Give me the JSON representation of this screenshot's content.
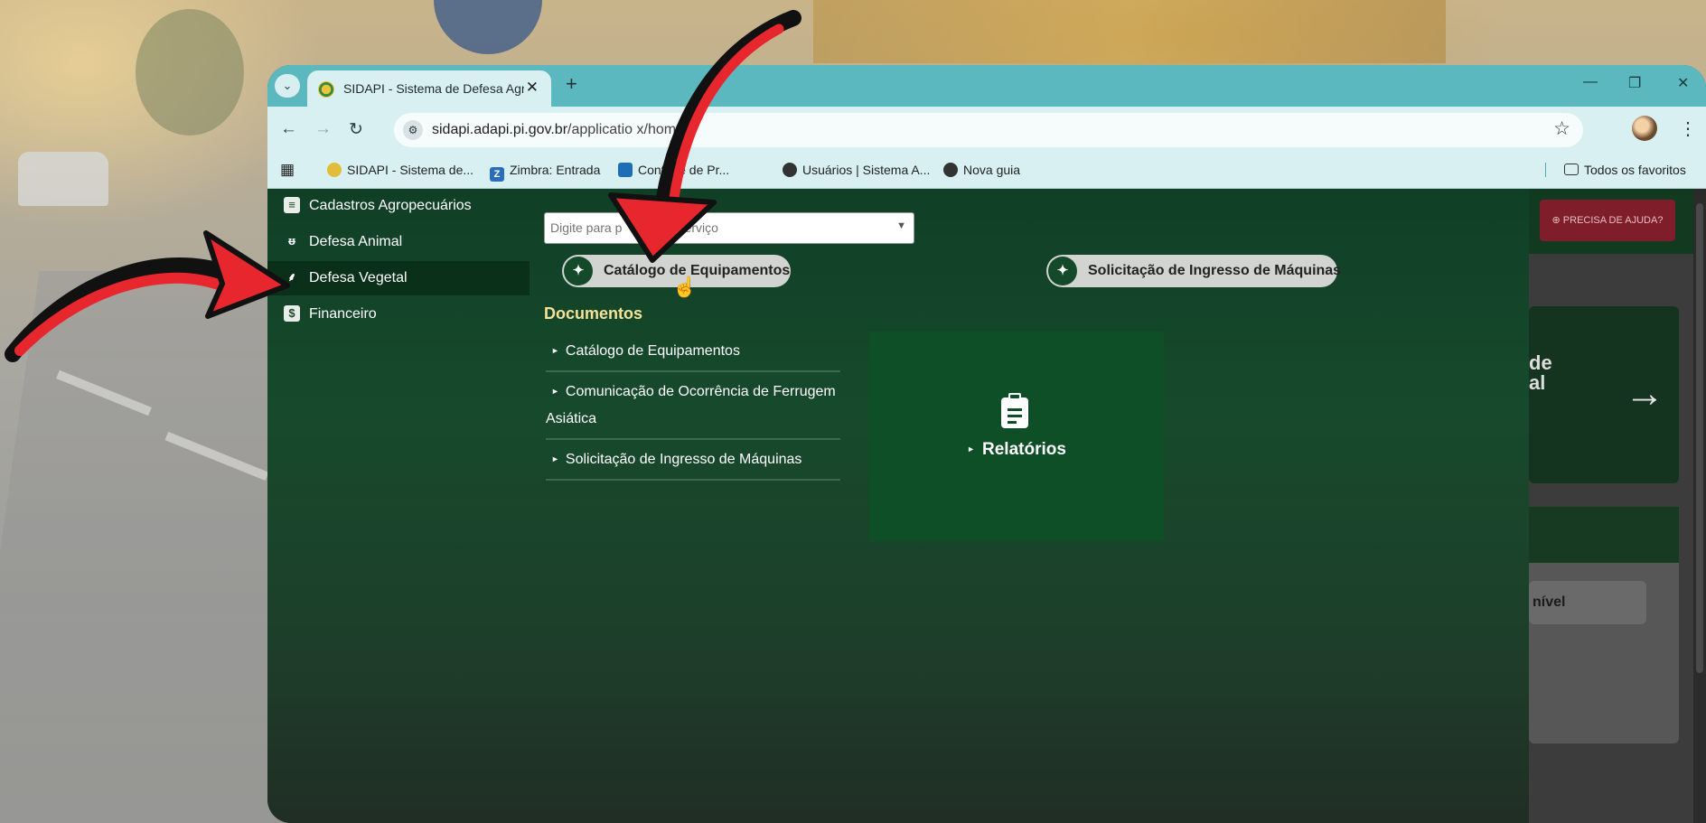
{
  "browser": {
    "tab_title": "SIDAPI - Sistema de Defesa Agr",
    "tab_close": "✕",
    "new_tab": "+",
    "url_host": "sidapi.adapi.pi.gov.br",
    "url_path": "/applicatio       x/home",
    "bookmarks": [
      {
        "label": "SIDAPI - Sistema de...",
        "icon": "sidapi-favicon"
      },
      {
        "label": "Zimbra: Entrada",
        "icon": "zimbra-icon",
        "glyph": "Z"
      },
      {
        "label": "Controle de Pr...",
        "icon": "sei-icon"
      },
      {
        "label": "Usuários | Sistema A...",
        "icon": "globe-icon"
      },
      {
        "label": "Nova guia",
        "icon": "globe-icon"
      }
    ],
    "all_bookmarks": "Todos os favoritos"
  },
  "sidebar": {
    "items": [
      {
        "label": "Cadastros Agropecuários",
        "icon": "document-icon"
      },
      {
        "label": "Defesa Animal",
        "icon": "cow-icon"
      },
      {
        "label": "Defesa Vegetal",
        "icon": "wheat-icon",
        "active": true
      },
      {
        "label": "Financeiro",
        "icon": "dollar-icon"
      }
    ]
  },
  "main": {
    "search_placeholder": "Digite para p          um serviço",
    "shortcuts": [
      {
        "label": "Catálogo de Equipamentos",
        "icon": "certificate-icon"
      },
      {
        "label": "Solicitação de Ingresso de Máquinas",
        "icon": "certificate-icon"
      }
    ],
    "documents_title": "Documentos",
    "documents": [
      "Catálogo de Equipamentos",
      "Comunicação de Ocorrência de Ferrugem Asiática",
      "Solicitação de Ingresso de Máquinas"
    ],
    "reports_label": "Relatórios"
  },
  "right_panel": {
    "help_button": "⊕ PRECISA DE AJUDA?",
    "card_text_line1": "de",
    "card_text_line2": "al",
    "button_fragment": "nível"
  },
  "colors": {
    "tabbar": "#5bb8bf",
    "page_green": "#103f26",
    "documents_title": "#f3e39a",
    "annotation_red": "#e8262e"
  }
}
